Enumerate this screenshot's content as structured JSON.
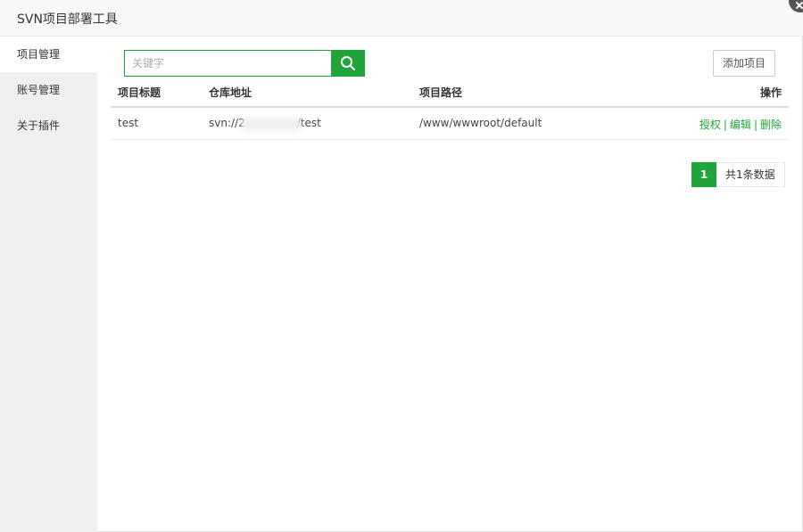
{
  "window": {
    "title": "SVN项目部署工具"
  },
  "sidebar": {
    "items": [
      {
        "label": "项目管理",
        "active": true
      },
      {
        "label": "账号管理",
        "active": false
      },
      {
        "label": "关于插件",
        "active": false
      }
    ]
  },
  "search": {
    "placeholder": "关键字",
    "value": "",
    "icon": "search-icon"
  },
  "toolbar": {
    "add_label": "添加项目"
  },
  "table": {
    "headers": {
      "title": "项目标题",
      "repo": "仓库地址",
      "path": "项目路径",
      "ops": "操作"
    },
    "rows": [
      {
        "title": "test",
        "repo_prefix": "svn://2",
        "repo_suffix": "/test",
        "path": "/www/wwwroot/default",
        "ops": {
          "authorize": "授权",
          "edit": "编辑",
          "delete": "删除",
          "sep": "|"
        }
      }
    ]
  },
  "pagination": {
    "current": "1",
    "total_text": "共1条数据"
  },
  "colors": {
    "accent": "#20a53a"
  }
}
